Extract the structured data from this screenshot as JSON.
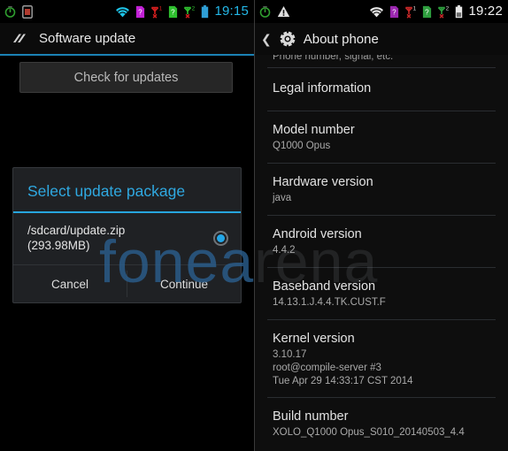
{
  "watermark": {
    "text": "fonearena"
  },
  "left_panel": {
    "status_bar": {
      "time": "19:15",
      "icons": [
        {
          "name": "usb-debugging-icon",
          "color": "#2f9e2f"
        },
        {
          "name": "sd-card-icon",
          "color": "#8a8a8a"
        },
        {
          "name": "wifi-icon",
          "color": "#1ec4e8"
        },
        {
          "name": "sim1-card-icon",
          "color": "#c221d6"
        },
        {
          "name": "signal-no-service-1-icon",
          "color": "#d61f1f",
          "label": "1"
        },
        {
          "name": "sim2-card-icon",
          "color": "#2fbf2f"
        },
        {
          "name": "signal-no-service-2-icon",
          "color": "#2fbf2f",
          "label": "2"
        },
        {
          "name": "battery-icon",
          "color": "#2f9fd6"
        }
      ]
    },
    "title_bar": {
      "title": "Software update",
      "icon": "software-update-icon"
    },
    "check_button": {
      "label": "Check for updates"
    },
    "dialog": {
      "title": "Select update package",
      "option": {
        "line1": "/sdcard/update.zip",
        "line2": "(293.98MB)",
        "selected": true
      },
      "cancel_label": "Cancel",
      "continue_label": "Continue"
    }
  },
  "right_panel": {
    "status_bar": {
      "time": "19:22",
      "icons": [
        {
          "name": "usb-debugging-icon",
          "color": "#2f9e2f"
        },
        {
          "name": "warning-triangle-icon",
          "color": "#e0e0e0"
        },
        {
          "name": "wifi-icon",
          "color": "#e8e8e8"
        },
        {
          "name": "sim1-card-icon",
          "color": "#9b27b0"
        },
        {
          "name": "signal-no-service-1-icon",
          "color": "#c62828",
          "label": "1"
        },
        {
          "name": "sim2-card-icon",
          "color": "#2e9e3e"
        },
        {
          "name": "signal-no-service-2-icon",
          "color": "#2e9e3e",
          "label": "2"
        },
        {
          "name": "battery-icon",
          "color": "#e8e8e8"
        }
      ]
    },
    "action_bar": {
      "title": "About phone",
      "back_icon": "back-chevron-icon",
      "app_icon": "settings-gear-icon"
    },
    "list": [
      {
        "title": "",
        "sub": "Phone number, signal, etc.",
        "clipped": true
      },
      {
        "title": "Legal information",
        "sub": ""
      },
      {
        "title": "Model number",
        "sub": "Q1000 Opus"
      },
      {
        "title": "Hardware version",
        "sub": "java"
      },
      {
        "title": "Android version",
        "sub": "4.4.2"
      },
      {
        "title": "Baseband version",
        "sub": "14.13.1.J.4.4.TK.CUST.F"
      },
      {
        "title": "Kernel version",
        "sub": "3.10.17\nroot@compile-server #3\nTue Apr 29 14:33:17 CST 2014"
      },
      {
        "title": "Build number",
        "sub": "XOLO_Q1000 Opus_S010_20140503_4.4"
      }
    ]
  }
}
